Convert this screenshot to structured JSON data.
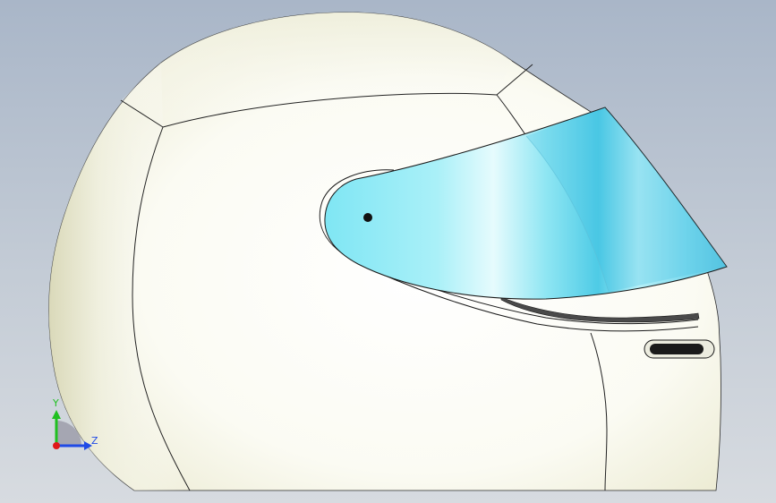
{
  "viewport": {
    "background_top": "#a9b6c8",
    "background_bottom": "#d7dbe0"
  },
  "model": {
    "shell_color": "#f4f4e2",
    "visor_color": "#7fe3f2",
    "edge_color": "#1a1a1a"
  },
  "triad": {
    "y_label": "Y",
    "z_label": "Z",
    "y_color": "#20c020",
    "z_color": "#1f4ae6",
    "x_color": "#e01818"
  }
}
